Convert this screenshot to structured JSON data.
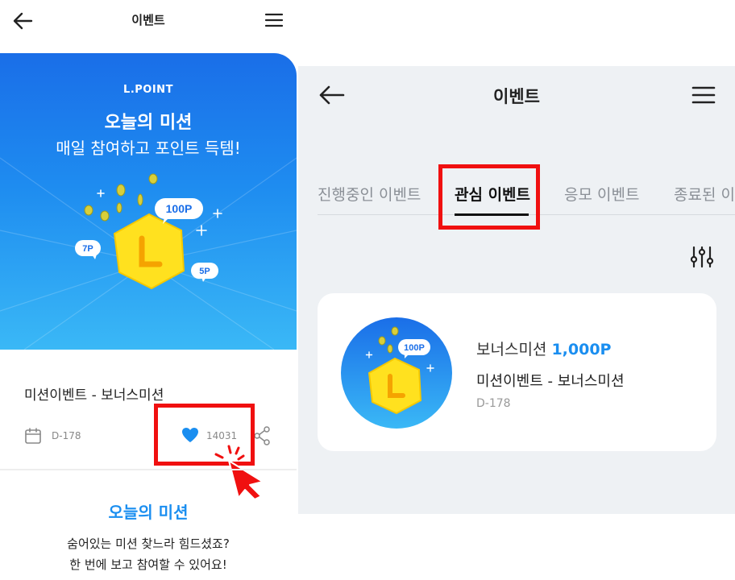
{
  "left": {
    "header": {
      "title": "이벤트",
      "back_icon": "arrow-left-icon",
      "menu_icon": "hamburger-menu-icon"
    },
    "banner": {
      "brand": "L.POINT",
      "title": "오늘의 미션",
      "subtitle": "매일 참여하고 포인트 득템!",
      "coin_letter": "L",
      "bubbles": [
        "100P",
        "7P",
        "5P"
      ],
      "gradient_top": "#1a6ee8",
      "gradient_bottom": "#3ab8f6",
      "coin_color": "#ffe11f"
    },
    "event": {
      "title": "미션이벤트 - 보너스미션",
      "dday": "D-178",
      "likes": "14031",
      "calendar_icon": "calendar-icon",
      "heart_icon": "heart-icon",
      "share_icon": "share-icon"
    },
    "mission": {
      "title": "오늘의 미션",
      "lines": [
        "숨어있는 미션 찾느라 힘드셨죠?",
        "한 번에 보고 참여할 수 있어요!"
      ]
    },
    "highlight_color": "#f01010",
    "cursor_icon": "hand-cursor-click-icon"
  },
  "right": {
    "header": {
      "title": "이벤트",
      "back_icon": "arrow-left-icon",
      "menu_icon": "hamburger-menu-icon"
    },
    "tabs": [
      {
        "label": "진행중인 이벤트",
        "active": false
      },
      {
        "label": "관심 이벤트",
        "active": true
      },
      {
        "label": "응모 이벤트",
        "active": false
      },
      {
        "label": "종료된 이벤트",
        "active": false
      }
    ],
    "filter_icon": "filter-sliders-icon",
    "card": {
      "reward_label": "보너스미션",
      "reward_points": "1,000P",
      "title": "미션이벤트 - 보너스미션",
      "dday": "D-178",
      "thumb_bubble": "100P",
      "coin_letter": "L"
    },
    "accent_color": "#1a8ef0"
  }
}
